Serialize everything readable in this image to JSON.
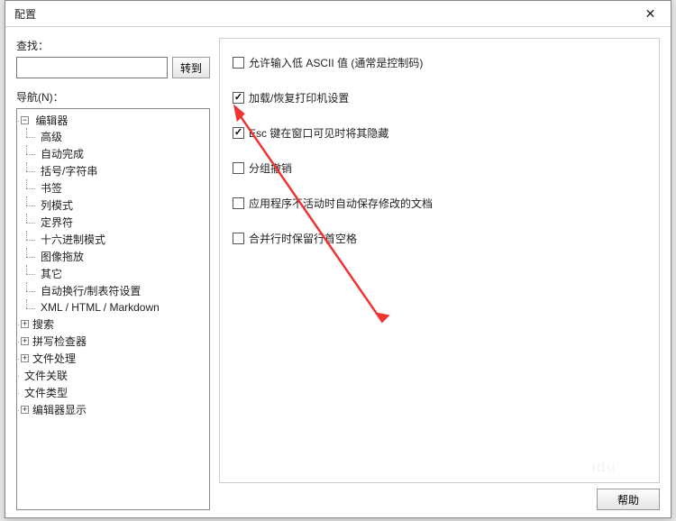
{
  "window": {
    "title": "配置",
    "close_glyph": "✕"
  },
  "left": {
    "find_label": "查找：",
    "find_value": "",
    "go_label": "转到",
    "nav_label": "导航(N)："
  },
  "tree": {
    "root": {
      "label": "编辑器",
      "expander": "−",
      "children": [
        {
          "label": "高级"
        },
        {
          "label": "自动完成"
        },
        {
          "label": "括号/字符串"
        },
        {
          "label": "书签"
        },
        {
          "label": "列模式"
        },
        {
          "label": "定界符"
        },
        {
          "label": "十六进制模式"
        },
        {
          "label": "图像拖放"
        },
        {
          "label": "其它"
        },
        {
          "label": "自动换行/制表符设置"
        },
        {
          "label": "XML / HTML / Markdown"
        }
      ]
    },
    "siblings": [
      {
        "label": "搜索",
        "expander": "+"
      },
      {
        "label": "拼写检查器",
        "expander": "+"
      },
      {
        "label": "文件处理",
        "expander": "+"
      },
      {
        "label": "文件关联"
      },
      {
        "label": "文件类型"
      },
      {
        "label": "编辑器显示",
        "expander": "+"
      }
    ]
  },
  "options": [
    {
      "label": "允许输入低 ASCII 值 (通常是控制码)",
      "checked": false
    },
    {
      "label": "加载/恢复打印机设置",
      "checked": true
    },
    {
      "label": "Esc 键在窗口可见时将其隐藏",
      "checked": true
    },
    {
      "label": "分组撤销",
      "checked": false
    },
    {
      "label": "应用程序不活动时自动保存修改的文档",
      "checked": false
    },
    {
      "label": "合并行时保留行首空格",
      "checked": false
    }
  ],
  "footer": {
    "help_label": "帮助"
  }
}
